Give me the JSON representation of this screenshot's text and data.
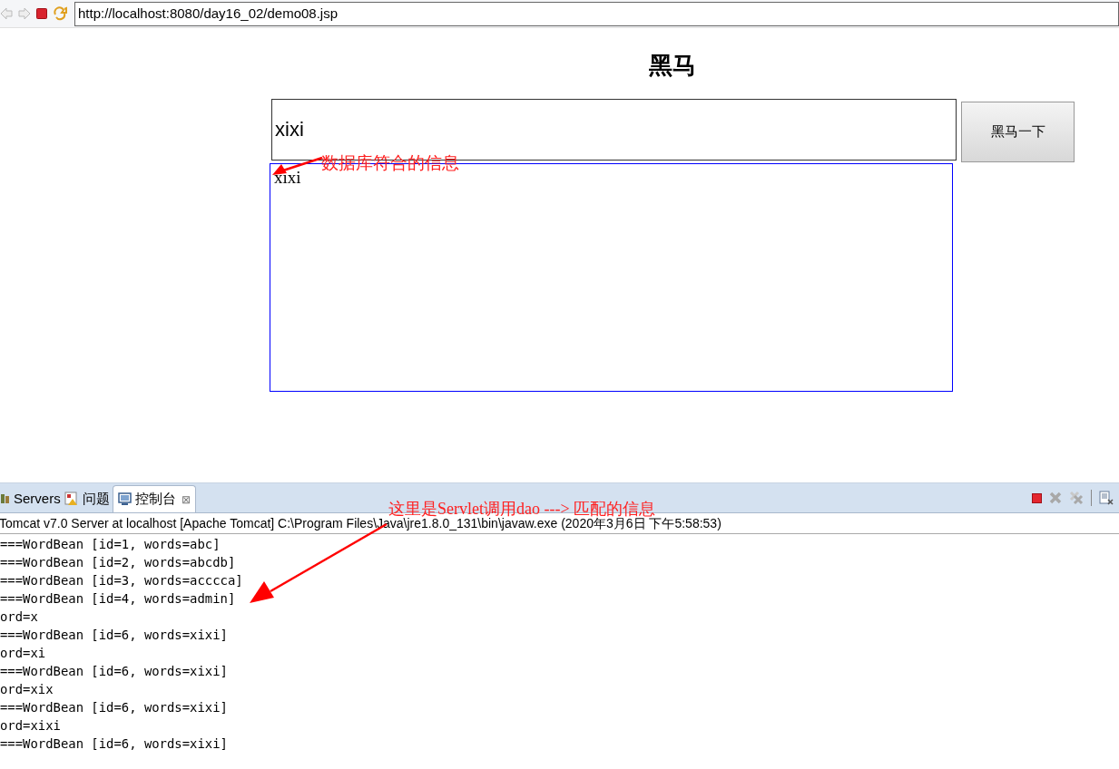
{
  "browser": {
    "url": "http://localhost:8080/day16_02/demo08.jsp"
  },
  "page": {
    "title": "黑马",
    "search_value": "xixi",
    "button": "黑马一下",
    "results": [
      "xixi"
    ]
  },
  "annotations": [
    {
      "text": "数据库符合的信息"
    },
    {
      "text": "这里是Servlet调用dao ---> 匹配的信息"
    }
  ],
  "console": {
    "tabs": [
      {
        "label": "Servers",
        "selected": false,
        "closable": false
      },
      {
        "label": "问题",
        "selected": false,
        "closable": false
      },
      {
        "label": "控制台",
        "selected": true,
        "closable": true
      }
    ],
    "close_glyph": "⊠",
    "header": "Tomcat v7.0 Server at localhost [Apache Tomcat] C:\\Program Files\\Java\\jre1.8.0_131\\bin\\javaw.exe  (2020年3月6日 下午5:58:53)",
    "lines": [
      "===WordBean [id=1, words=abc]",
      "===WordBean [id=2, words=abcdb]",
      "===WordBean [id=3, words=acccca]",
      "===WordBean [id=4, words=admin]",
      "ord=x",
      "===WordBean [id=6, words=xixi]",
      "ord=xi",
      "===WordBean [id=6, words=xixi]",
      "ord=xix",
      "===WordBean [id=6, words=xixi]",
      "ord=xixi",
      "===WordBean [id=6, words=xixi]"
    ]
  }
}
